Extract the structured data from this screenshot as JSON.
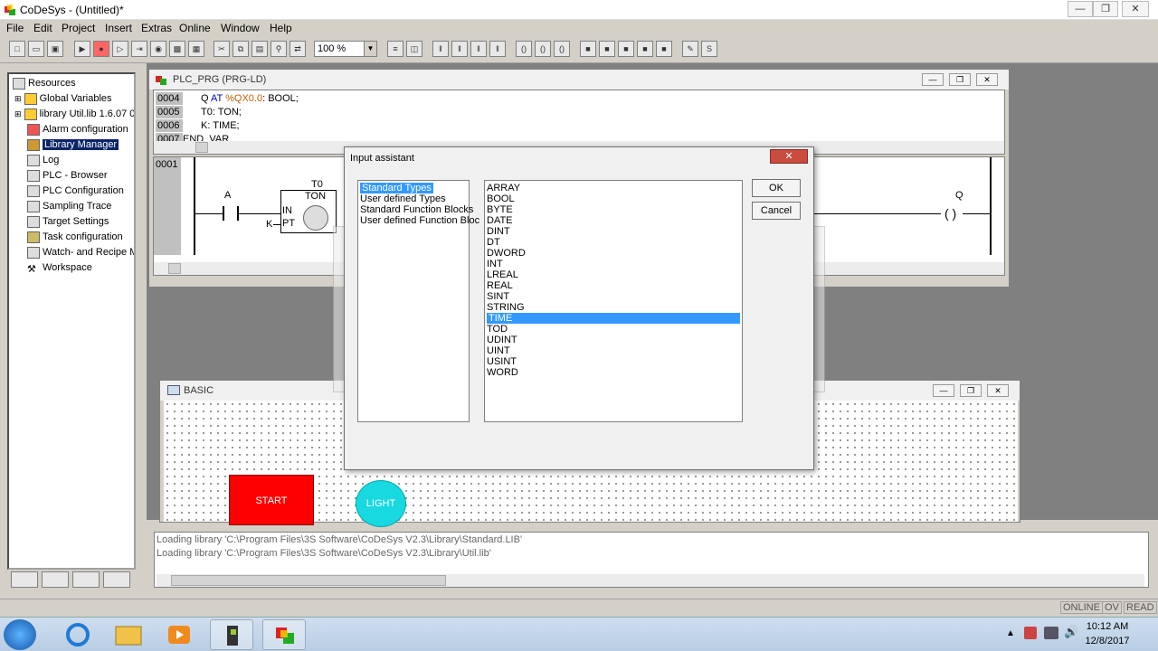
{
  "window": {
    "title": "CoDeSys - (Untitled)*"
  },
  "menu": [
    "File",
    "Edit",
    "Project",
    "Insert",
    "Extras",
    "Online",
    "Window",
    "Help"
  ],
  "toolbar": {
    "zoom": "100 %"
  },
  "resources_tree": {
    "root": "Resources",
    "items": [
      "Global Variables",
      "library Util.lib 1.6.07 09",
      "Alarm configuration",
      "Library Manager",
      "Log",
      "PLC - Browser",
      "PLC Configuration",
      "Sampling Trace",
      "Target Settings",
      "Task configuration",
      "Watch- and Recipe M",
      "Workspace"
    ],
    "selected": "Library Manager"
  },
  "plc_window": {
    "title": "PLC_PRG (PRG-LD)",
    "decl_lines": [
      {
        "num": "0004",
        "name": "Q",
        "kw": "AT",
        "addr": "%QX0.0",
        "type": ": BOOL;"
      },
      {
        "num": "0005",
        "name": "T0",
        "type": ": TON;"
      },
      {
        "num": "0006",
        "name": "K",
        "type": ": TIME;"
      },
      {
        "num": "0007",
        "name": "END_VAR"
      }
    ],
    "network_num": "0001",
    "contact_label": "A",
    "timer_instance": "T0",
    "timer_type": "TON",
    "timer_in": "IN",
    "timer_pt": "PT",
    "pt_input": "K",
    "coil_label": "Q",
    "coil_symbol": "( )"
  },
  "basic_window": {
    "title": "BASIC",
    "start_label": "START",
    "light_label": "LIGHT"
  },
  "dialog": {
    "title": "Input assistant",
    "categories": [
      "Standard Types",
      "User defined Types",
      "Standard Function Blocks",
      "User defined Function Bloc"
    ],
    "selected_category": "Standard Types",
    "types": [
      "ARRAY",
      "BOOL",
      "BYTE",
      "DATE",
      "DINT",
      "DT",
      "DWORD",
      "INT",
      "LREAL",
      "REAL",
      "SINT",
      "STRING",
      "TIME",
      "TOD",
      "UDINT",
      "UINT",
      "USINT",
      "WORD"
    ],
    "selected_type": "TIME",
    "ok_label": "OK",
    "cancel_label": "Cancel"
  },
  "messages": [
    "Loading library 'C:\\Program Files\\3S Software\\CoDeSys V2.3\\Library\\Standard.LIB'",
    "Loading library 'C:\\Program Files\\3S Software\\CoDeSys V2.3\\Library\\Util.lib'"
  ],
  "status": {
    "online": "ONLINE",
    "ov": "OV",
    "read": "READ"
  },
  "taskbar": {
    "time": "10:12 AM",
    "date": "12/8/2017"
  }
}
